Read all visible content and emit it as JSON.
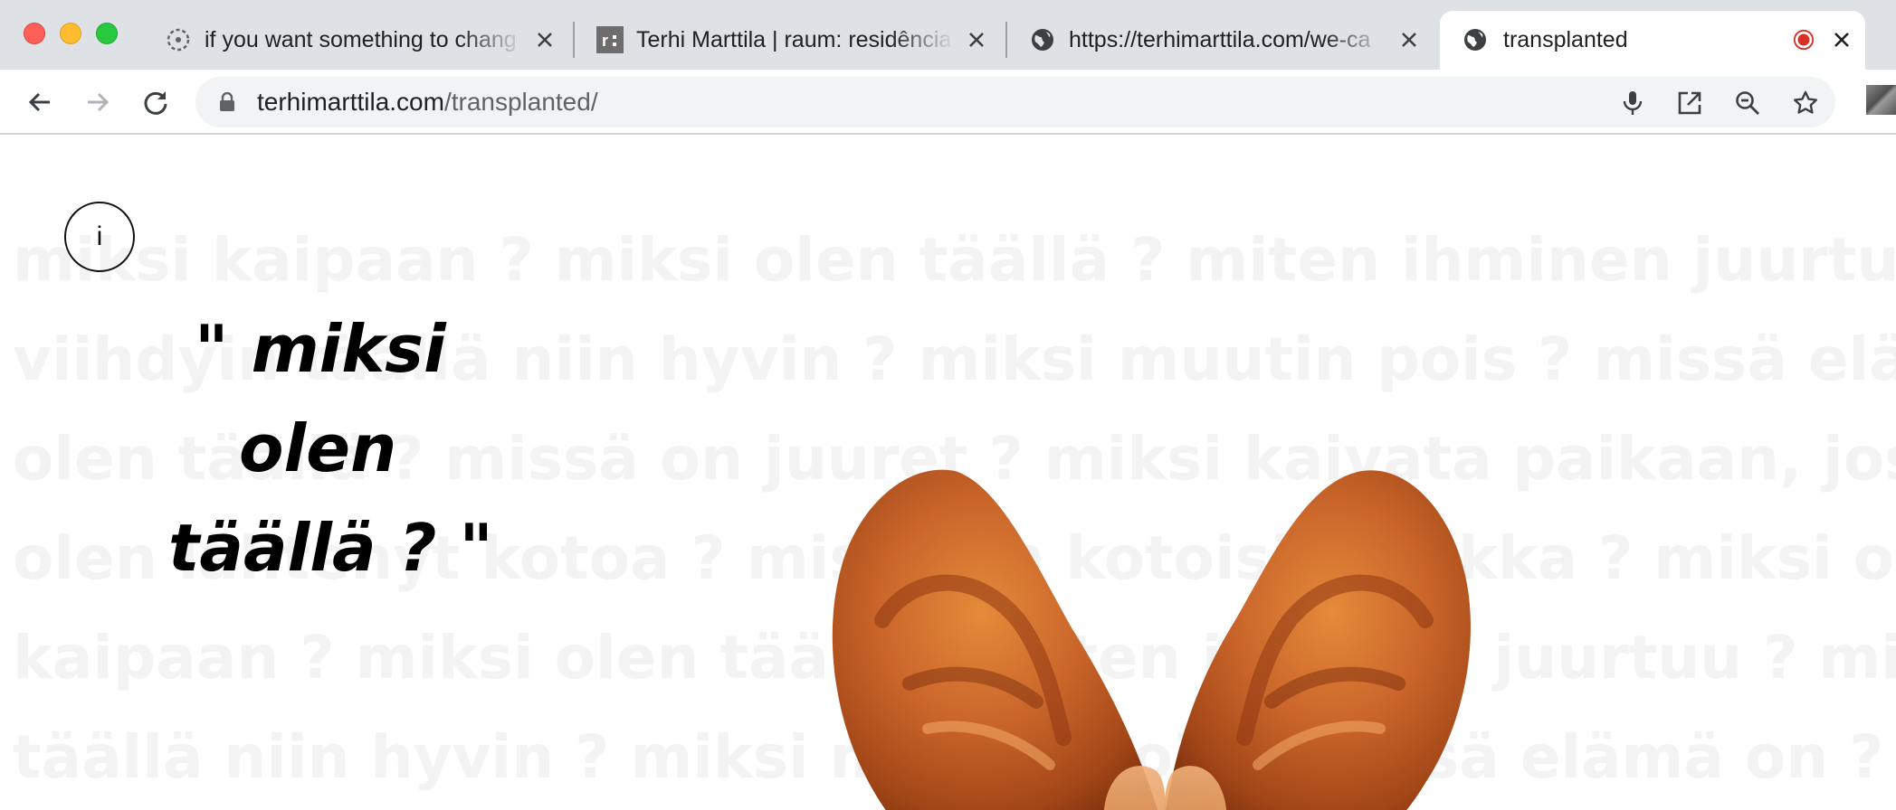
{
  "browser": {
    "tabs": [
      {
        "title": "if you want something to chang",
        "favicon": "dotted-circle-icon",
        "active": false
      },
      {
        "title": "Terhi Marttila | raum: residência",
        "favicon": "raum-logo-icon",
        "active": false
      },
      {
        "title": "https://terhimarttila.com/we-ca",
        "favicon": "globe-icon",
        "active": false
      },
      {
        "title": "transplanted",
        "favicon": "globe-icon",
        "active": true
      }
    ],
    "address": {
      "host": "terhimarttila.com",
      "path": "/transplanted/"
    },
    "icons": {
      "back": "arrow-left-icon",
      "forward": "arrow-right-icon",
      "reload": "reload-icon",
      "lock": "lock-icon",
      "mic": "microphone-icon",
      "open": "open-in-new-icon",
      "zoom": "zoom-out-icon",
      "star": "star-icon",
      "recording": "recording-indicator-icon"
    },
    "colors": {
      "tab_strip": "#dee1e6",
      "omnibox": "#f1f3f4",
      "recording": "#d93025"
    }
  },
  "page": {
    "info_button": "i",
    "quote": {
      "line1": "\" miksi",
      "line2": "olen",
      "line3": "täällä ? \""
    },
    "background_lines": [
      "miksi kaipaan ? miksi olen täällä ? miten ihminen juurtuu ? miksi",
      "viihdyin täällä niin hyvin ? miksi muutin pois ? missä elämä on ? miksi",
      "olen täällä ? missä on juuret ? miksi kaivata paikaan, jossa ei ole",
      "olen lähtenyt kotoa ? missä on kotoisin paikka ? miksi olen täällä ? miksi",
      "kaipaan ? miksi olen täällä ? miten ihminen juurtuu ? miksi",
      "täällä niin hyvin ? miksi muutin pois ? missä elämä on ? miksi"
    ],
    "colors": {
      "background_text": "#f3f3f3",
      "quote": "#000000"
    }
  }
}
